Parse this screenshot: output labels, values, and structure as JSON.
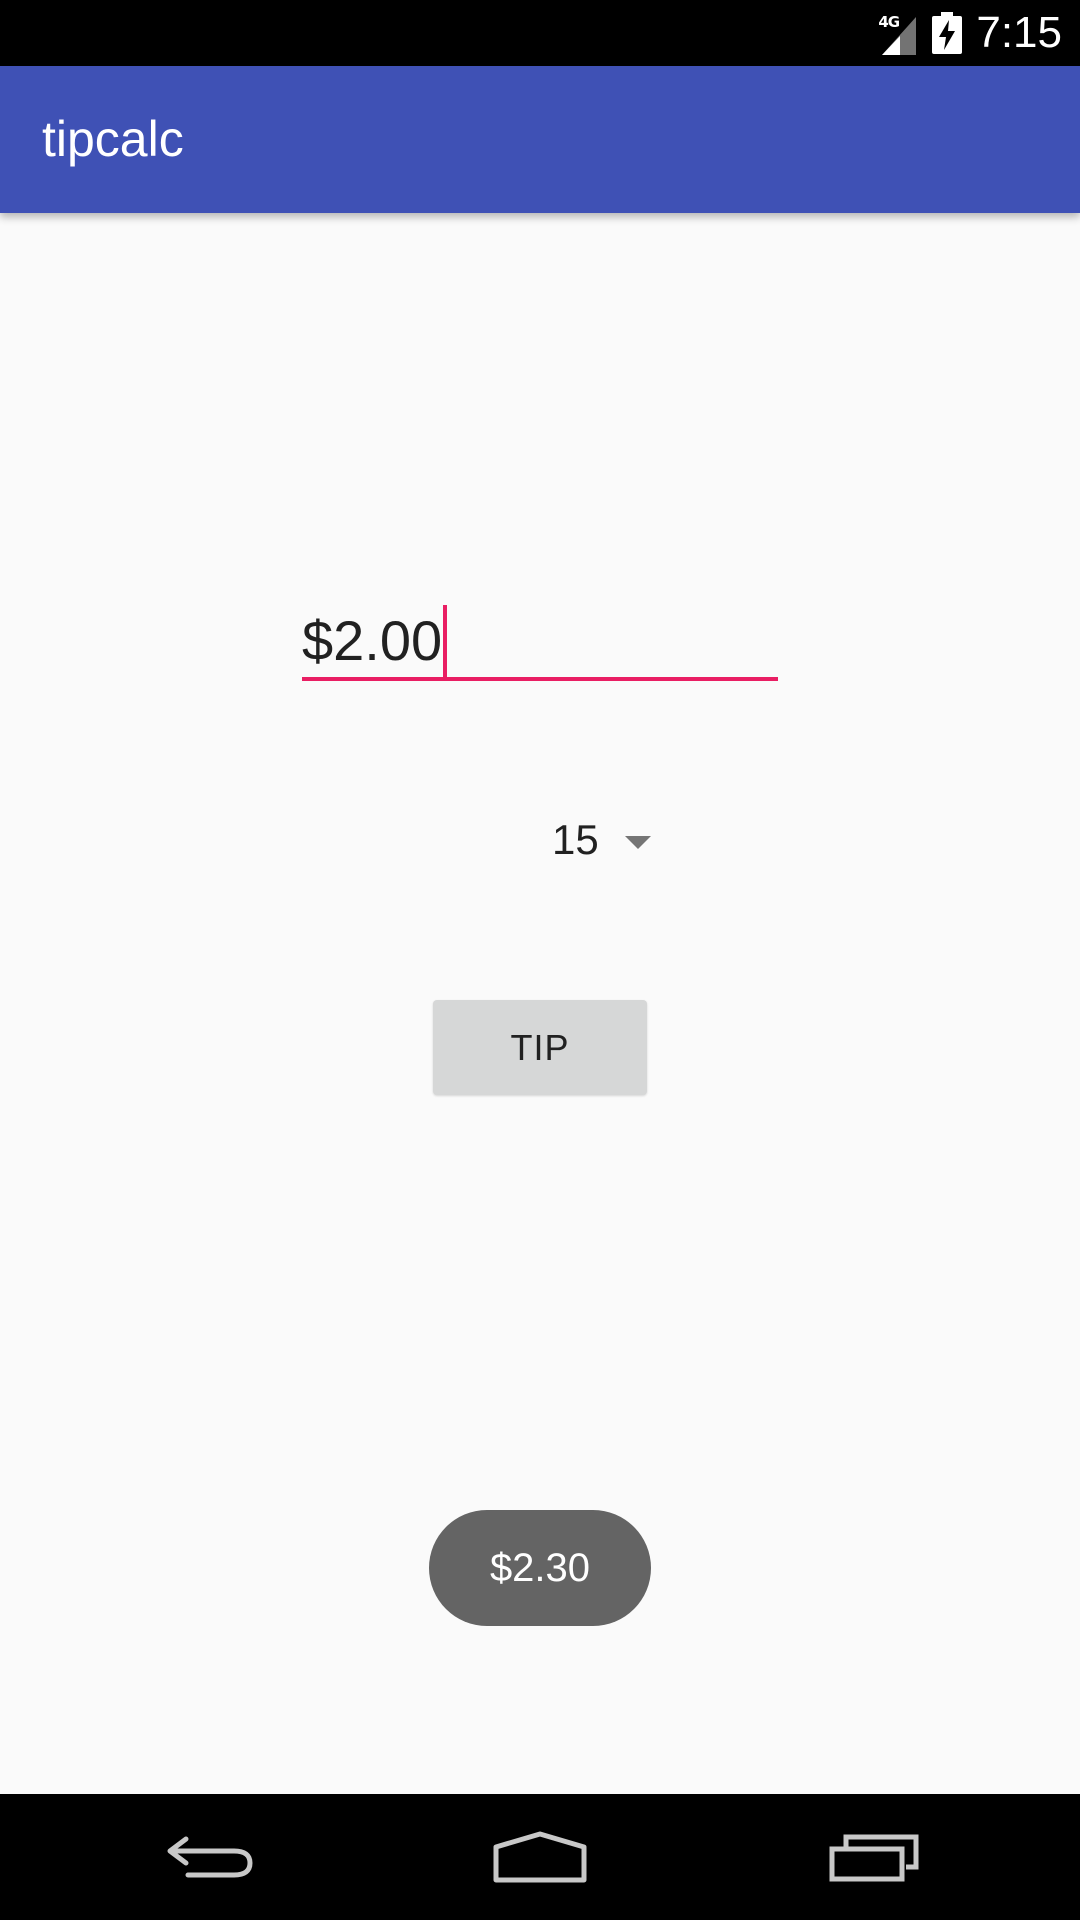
{
  "status_bar": {
    "network_label": "4G",
    "time": "7:15",
    "icons": [
      "signal-icon",
      "battery-charging-icon"
    ]
  },
  "app_bar": {
    "title": "tipcalc",
    "color": "#3F51B5"
  },
  "amount_input": {
    "value": "$2.00",
    "accent_color": "#E91E63"
  },
  "tip_spinner": {
    "selected": "15"
  },
  "tip_button": {
    "label": "TIP"
  },
  "toast": {
    "message": "$2.30"
  },
  "nav_bar": {
    "icons": [
      "back-icon",
      "home-icon",
      "recents-icon"
    ]
  }
}
